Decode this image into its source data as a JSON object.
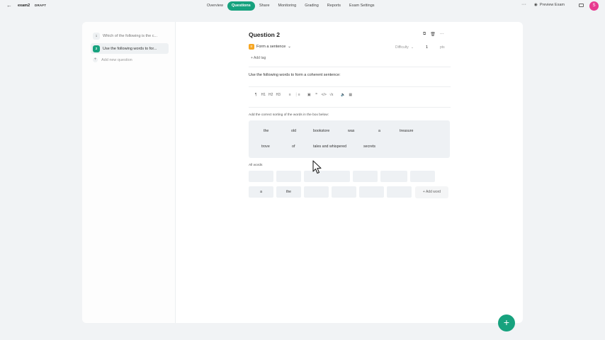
{
  "header": {
    "back_icon": "arrow-left-icon",
    "exam_name": "exam2",
    "status": "DRAFT",
    "tabs": [
      {
        "label": "Overview",
        "active": false
      },
      {
        "label": "Questions",
        "active": true
      },
      {
        "label": "Share",
        "active": false
      },
      {
        "label": "Monitoring",
        "active": false
      },
      {
        "label": "Grading",
        "active": false
      },
      {
        "label": "Reports",
        "active": false
      },
      {
        "label": "Exam Settings",
        "active": false
      }
    ],
    "more_glyph": "···",
    "preview_label": "Preview Exam",
    "avatar_initial": "S",
    "avatar_color": "#e73a8f",
    "accent_color": "#17a27e"
  },
  "sidebar": {
    "questions": [
      {
        "number": "1",
        "text": "Which of the following is the c..."
      },
      {
        "number": "2",
        "text": "Use the following words to for..."
      }
    ],
    "add_label": "Add new question"
  },
  "question": {
    "title": "Question 2",
    "type_label": "Form a sentence",
    "difficulty_label": "Difficulty",
    "points_value": "1",
    "points_unit": "pts",
    "add_tag_label": "+ Add tag",
    "prompt": "Use the following words to form a coherent sentence:",
    "toolbar_icons": [
      "text-icon",
      "h1-icon",
      "h2-icon",
      "h3-icon",
      "bullet-list-icon",
      "numbered-list-icon",
      "image-icon",
      "quote-icon",
      "code-icon",
      "formula-icon",
      "audio-icon",
      "table-icon"
    ],
    "toolbar_glyphs": [
      "¶",
      "H1",
      "H2",
      "H3",
      "≡",
      "⋮≡",
      "▣",
      "❞",
      "</>",
      "√x",
      "🔈",
      "▦"
    ],
    "sort_label": "Add the correct sorting of the words in the box below:",
    "sorted_words_row1": [
      "the",
      "old",
      "bookstore",
      "was",
      "a",
      "treasure"
    ],
    "sorted_words_row2": [
      "trove",
      "of",
      "tales and whispered",
      "secrets"
    ],
    "all_words_label": "All words",
    "chips_row2": [
      "a",
      "the"
    ],
    "add_word_label": "+ Add word"
  },
  "fab_label": "+"
}
